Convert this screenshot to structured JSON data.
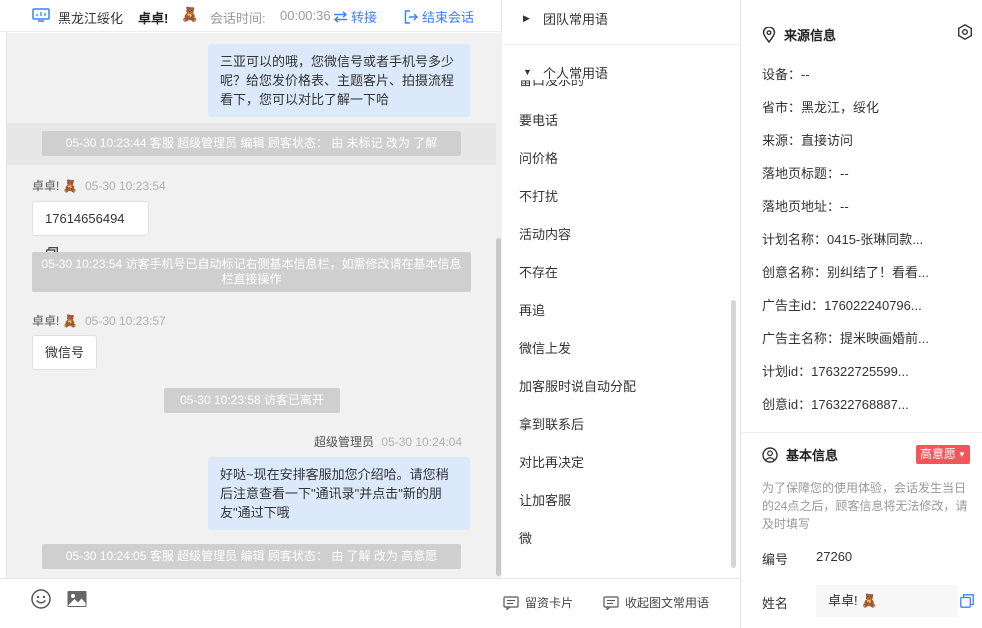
{
  "header": {
    "source_region": "黑龙江绥化",
    "visitor_name": "卓卓!",
    "visitor_emoji": "🧸",
    "time_label": "会话时间:",
    "time_value": "00:00:36",
    "transfer_label": "转接",
    "end_label": "结束会话"
  },
  "messages": {
    "m1_text": "三亚可以的哦，您微信号或者手机号多少呢？给您发价格表、主题客片、拍摄流程看下，您可以对比了解一下哈",
    "sys1": "05-30 10:23:44 客服 超级管理员 编辑 顾客状态： 由 未标记 改为 了解",
    "m2_sender": "卓卓!",
    "m2_time": "05-30 10:23:54",
    "m2_text": "17614656494",
    "sys2": "05-30 10:23:54 访客手机号已自动标记右侧基本信息栏，如需修改请在基本信息栏直接操作",
    "m3_sender": "卓卓!",
    "m3_time": "05-30 10:23:57",
    "m3_text": "微信号",
    "sys3": "05-30 10:23:58 访客已离开",
    "m4_sender": "超级管理员",
    "m4_time": "05-30 10:24:04",
    "m4_text": "好哒~现在安排客服加您介绍哈。请您稍后注意查看一下\"通讯录\"并点击\"新的朋友\"通过下哦",
    "sys4": "05-30 10:24:05 客服 超级管理员 编辑 顾客状态： 由 了解 改为 高意愿"
  },
  "quick_replies": {
    "team_group": "团队常用语",
    "personal_group": "个人常用语",
    "partial_item": "留口没水的",
    "items": [
      "要电话",
      "问价格",
      "不打扰",
      "活动内容",
      "不存在",
      "再追",
      "微信上发",
      "加客服时说自动分配",
      "拿到联系后",
      "对比再决定",
      "让加客服",
      "微"
    ],
    "btn_card": "留资卡片",
    "btn_collapse": "收起图文常用语"
  },
  "source_info": {
    "title": "来源信息",
    "device": "设备：--",
    "province": "省市：黑龙江，绥化",
    "source": "来源：直接访问",
    "landing_title": "落地页标题：--",
    "landing_url": "落地页地址：--",
    "plan_name": "计划名称：0415-张琳同款...",
    "creative_name": "创意名称：别纠结了！看看...",
    "advertiser_id": "广告主id：176022240796...",
    "advertiser_name": "广告主名称：提米映画婚前...",
    "plan_id": "计划id：176322725599...",
    "creative_id": "创意id：176322768887..."
  },
  "basic_info": {
    "title": "基本信息",
    "badge": "高意愿",
    "note": "为了保障您的使用体验，会话发生当日的24点之后，顾客信息将无法修改，请及时填写",
    "number_label": "编号",
    "number_value": "27260",
    "name_label": "姓名",
    "name_value": "卓卓!"
  },
  "colors": {
    "accent": "#3b82f6",
    "bubble_right": "#dce9fb",
    "badge": "#f5555a",
    "system_bg": "#cfcfcf"
  },
  "icons": [
    "monitor-icon",
    "transfer-icon",
    "logout-icon",
    "copy-icon",
    "emoji-icon",
    "image-icon",
    "card-icon",
    "message-icon",
    "location-icon",
    "settings-icon",
    "user-icon"
  ]
}
